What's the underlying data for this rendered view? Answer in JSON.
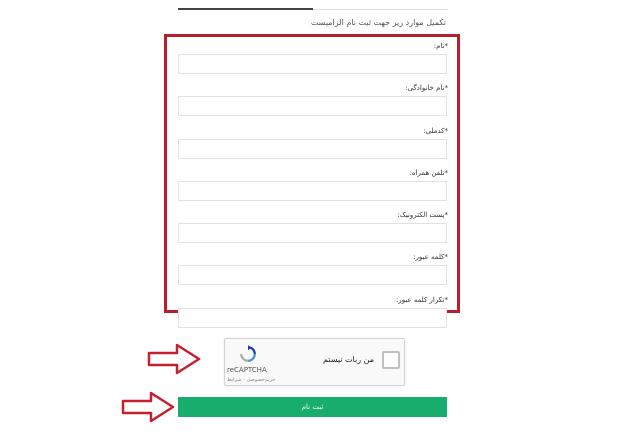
{
  "intro_text": "تکمیل موارد زیر جهت ثبت نام الزامیست",
  "fields": [
    {
      "label": "*نام:",
      "value": "",
      "placeholder": ""
    },
    {
      "label": "*نام خانوادگی:",
      "value": "",
      "placeholder": ""
    },
    {
      "label": "*کدملی:",
      "value": "",
      "placeholder": ""
    },
    {
      "label": "*تلفن همراه:",
      "value": "",
      "placeholder": ""
    },
    {
      "label": "*پست الکترونیک:",
      "value": "",
      "placeholder": ""
    },
    {
      "label": "*کلمه عبور:",
      "value": "",
      "placeholder": ""
    },
    {
      "label": "*تکرار کلمه عبور:",
      "value": "",
      "placeholder": ""
    }
  ],
  "captcha": {
    "checkbox_text": "من ربات نیستم",
    "brand": "reCAPTCHA",
    "terms": "حریم‌خصوصی - شرایط"
  },
  "submit_label": "ثبت نام",
  "colors": {
    "accent": "#18ad6c",
    "highlight": "#b5202c"
  },
  "icons": {
    "arrow": "red-outline-arrow-right-icon",
    "captcha_logo": "recaptcha-logo-icon"
  }
}
